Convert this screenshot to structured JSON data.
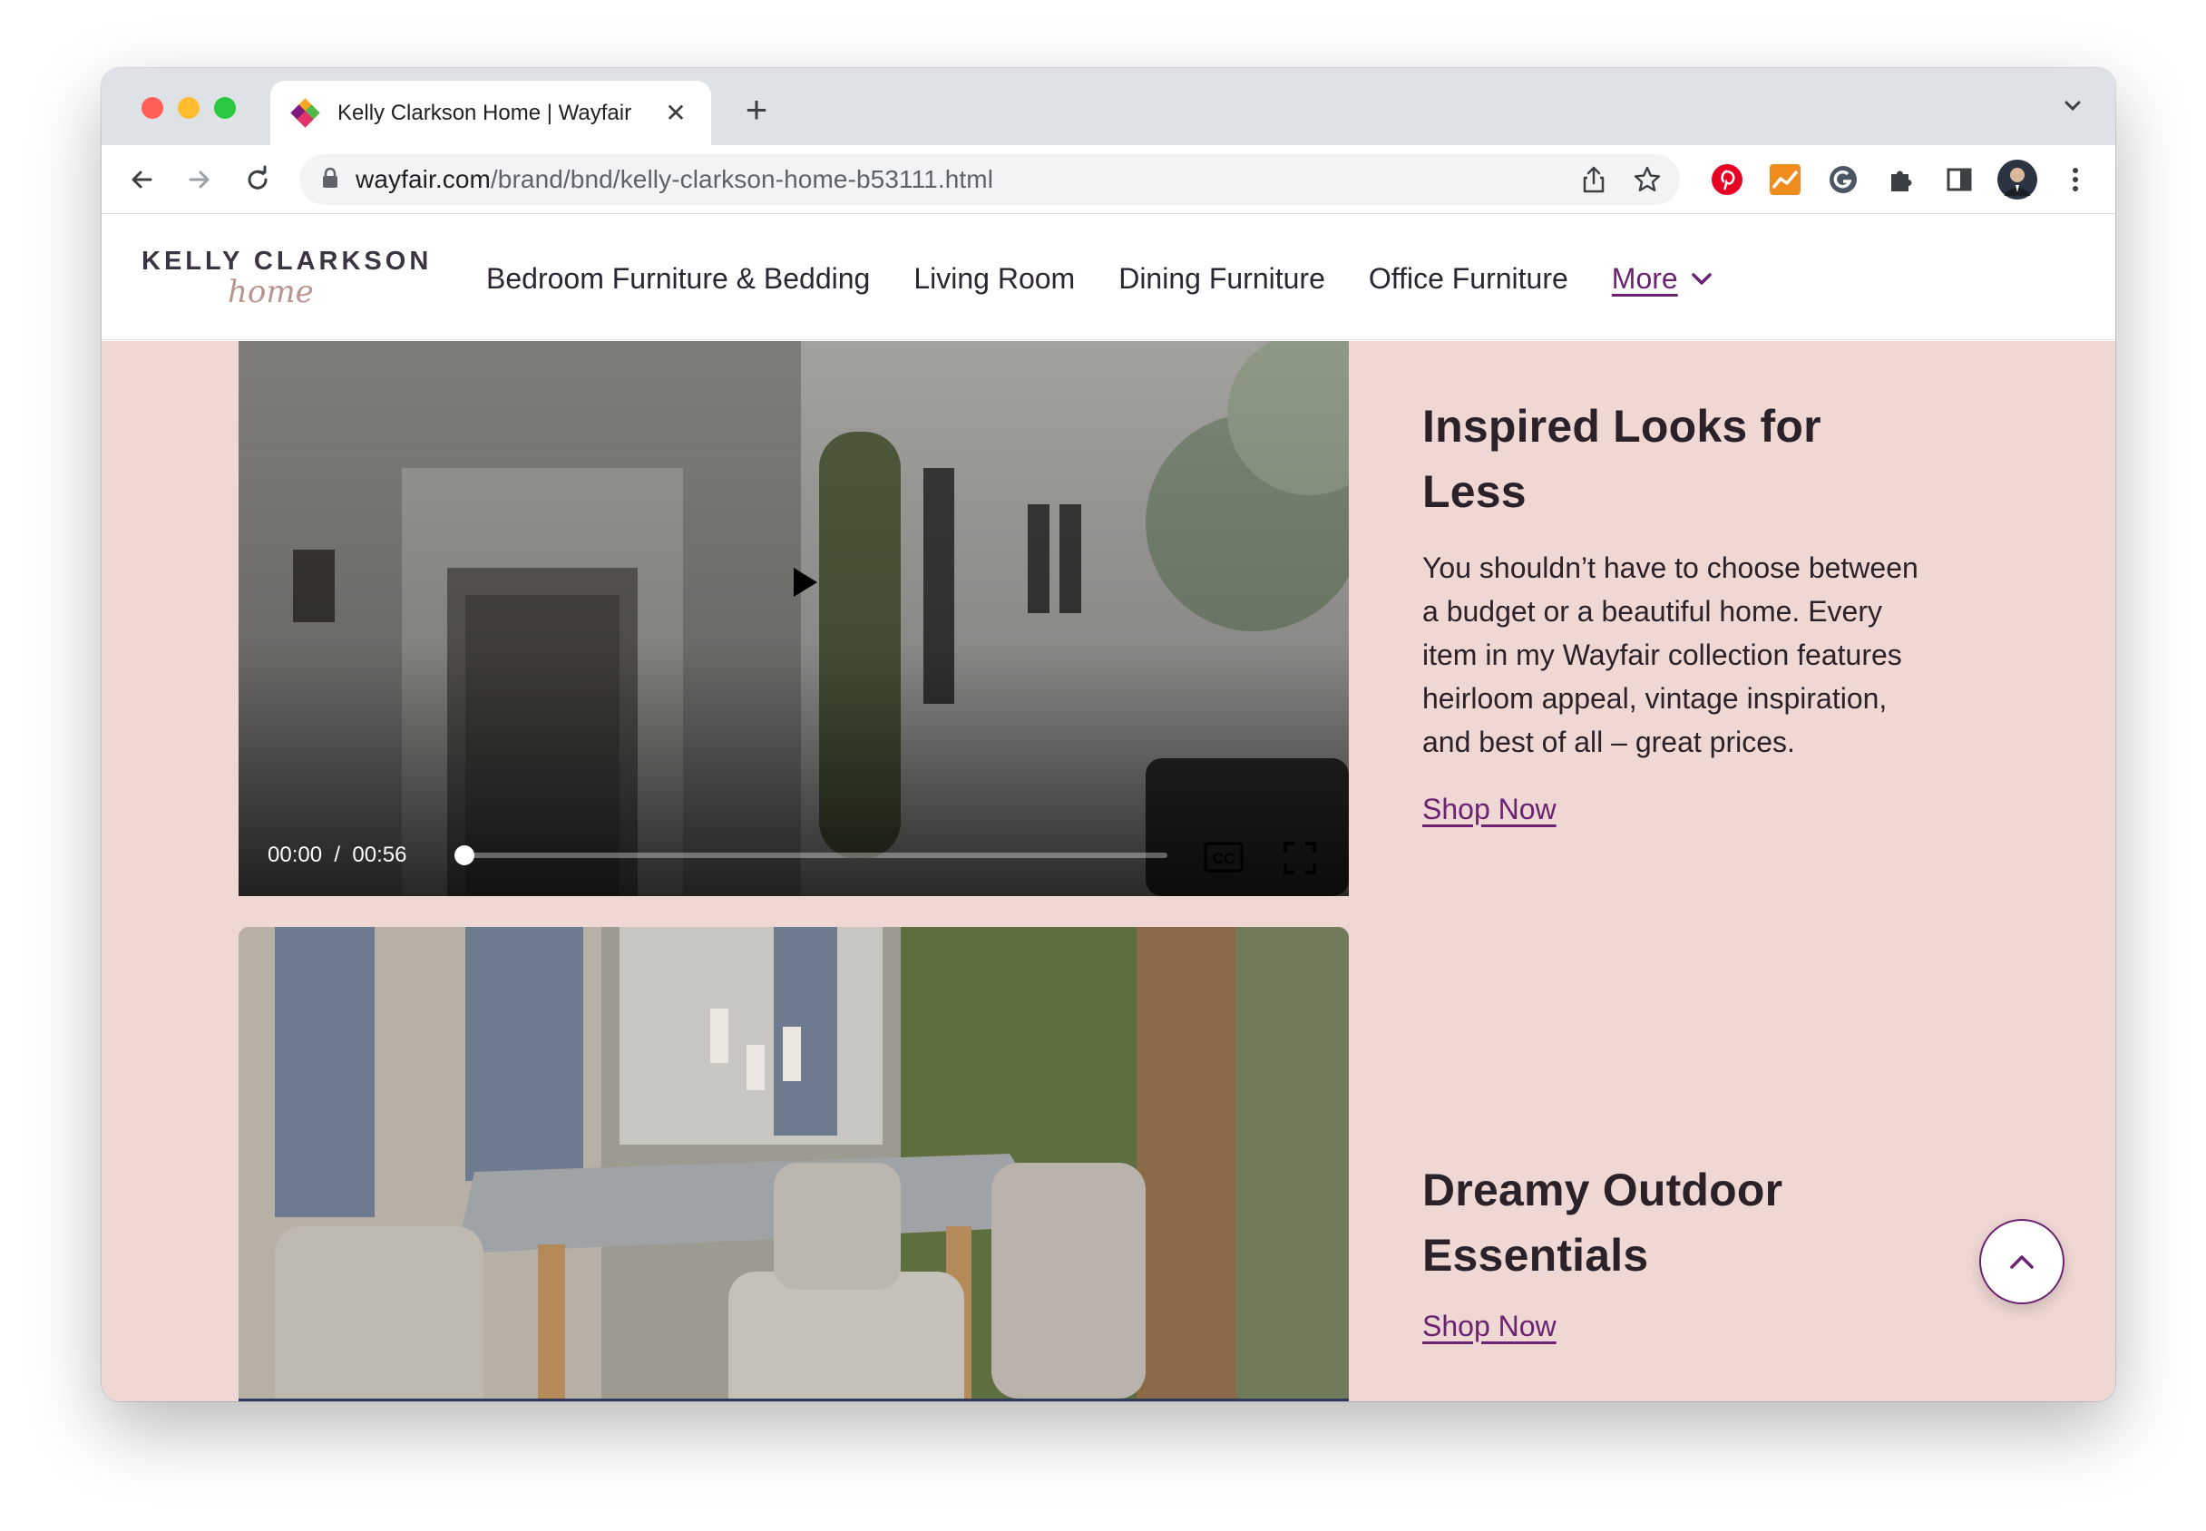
{
  "browser": {
    "tab_title": "Kelly Clarkson Home | Wayfair",
    "tab_close": "✕",
    "new_tab": "+",
    "url_host": "wayfair.com",
    "url_path": "/brand/bnd/kelly-clarkson-home-b53111.html"
  },
  "header": {
    "logo_top": "KELLY CLARKSON",
    "logo_script": "home",
    "nav": [
      {
        "label": "Bedroom Furniture & Bedding"
      },
      {
        "label": "Living Room"
      },
      {
        "label": "Dining Furniture"
      },
      {
        "label": "Office Furniture"
      }
    ],
    "more_label": "More"
  },
  "video": {
    "current_time": "00:00",
    "separator": "/",
    "duration": "00:56",
    "progress": 0
  },
  "sections": [
    {
      "heading": "Inspired Looks for Less",
      "body": "You shouldn’t have to choose between a budget or a beautiful home. Every item in my Wayfair collection features heirloom appeal, vintage inspiration, and best of all – great prices.",
      "cta": "Shop Now"
    },
    {
      "heading": "Dreamy Outdoor Essentials",
      "cta": "Shop Now"
    }
  ],
  "colors": {
    "accent": "#6b2272",
    "content_bg": "#efd7d3",
    "text": "#2a2228"
  }
}
